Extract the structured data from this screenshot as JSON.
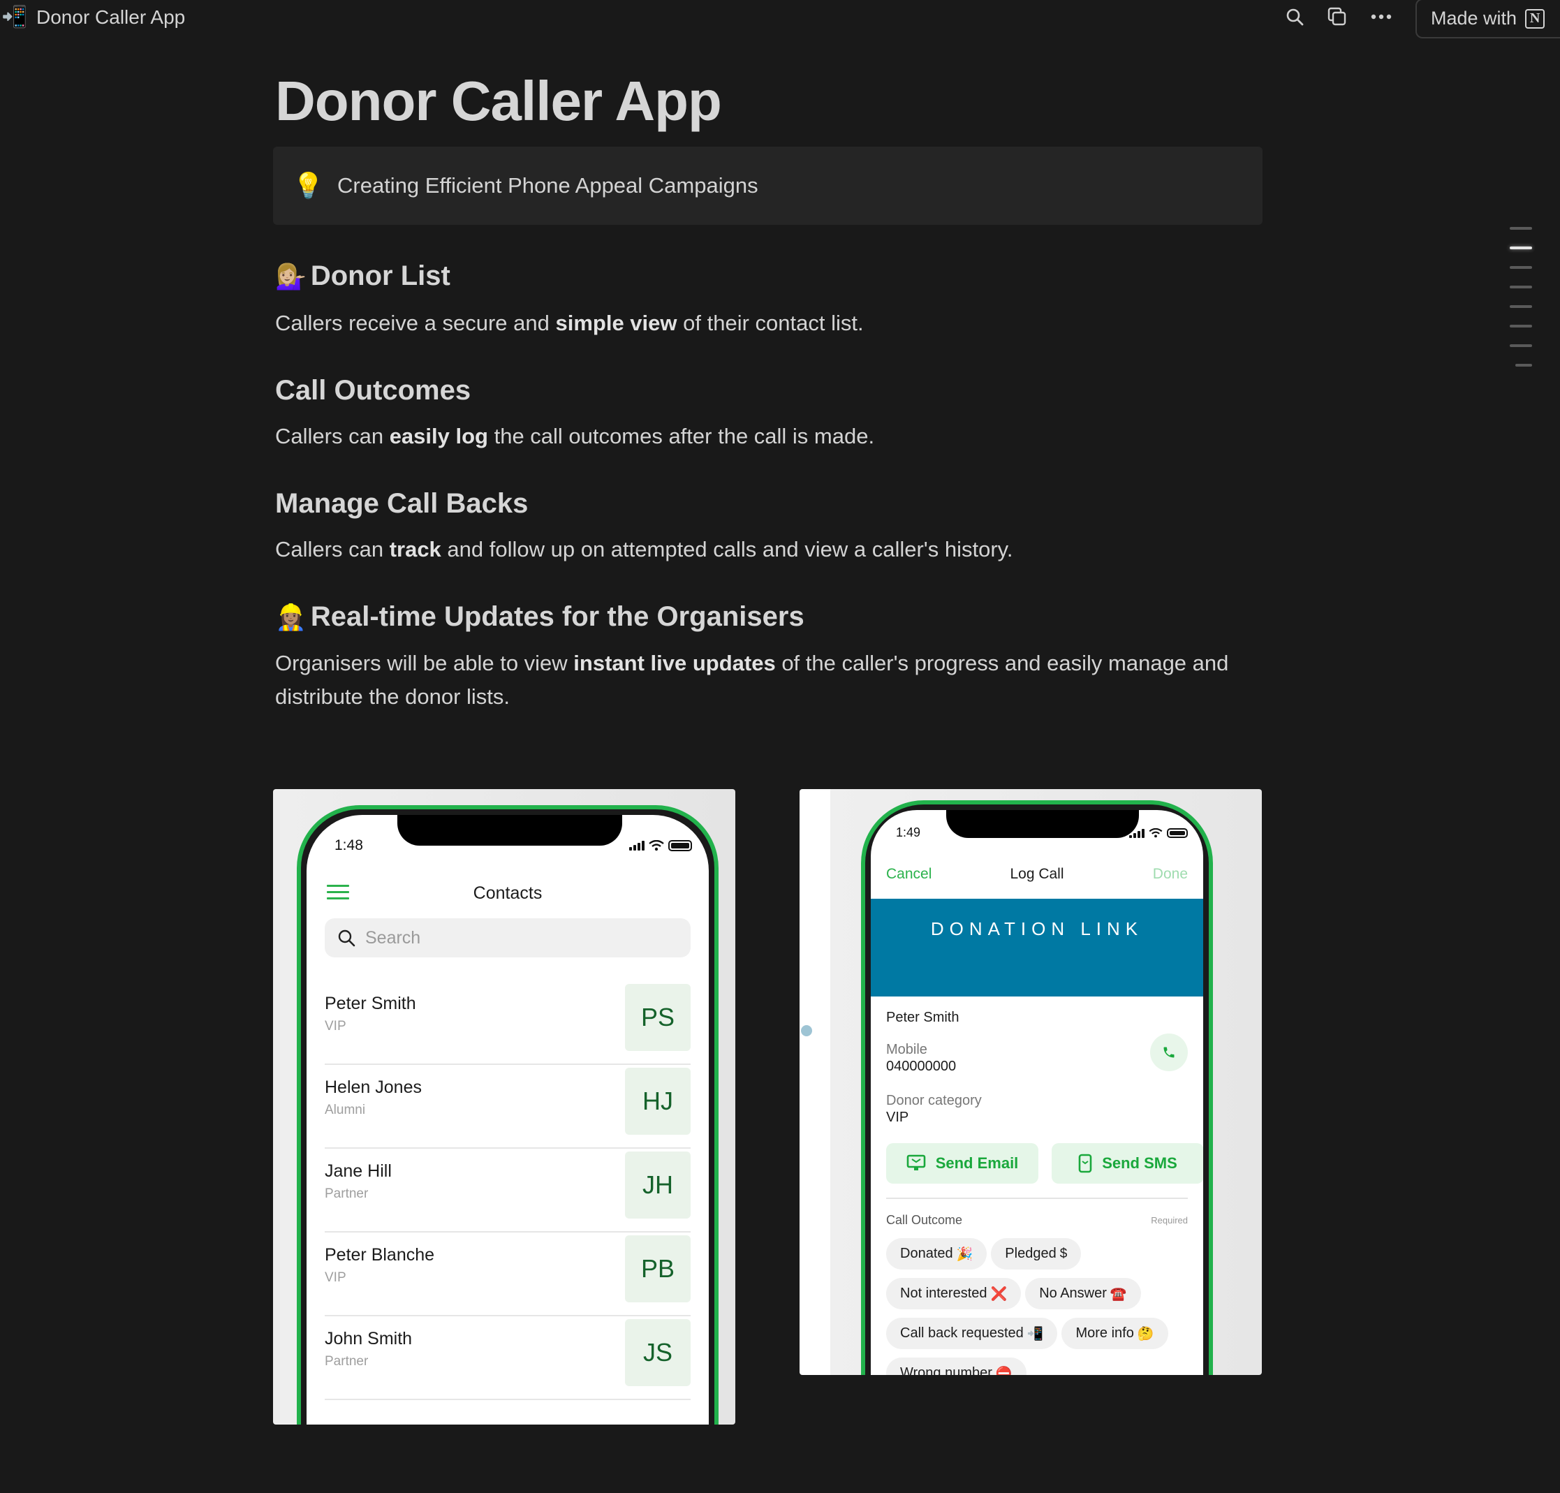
{
  "topbar": {
    "page_icon": "📲",
    "title": "Donor Caller App",
    "icons": [
      "search-icon",
      "duplicate-icon",
      "more-icon"
    ],
    "made_with_label": "Made with",
    "made_with_logo": "N"
  },
  "page": {
    "title": "Donor Caller App",
    "callout": {
      "icon": "💡",
      "text": "Creating Efficient Phone Appeal Campaigns"
    },
    "sections": [
      {
        "emoji": "💁🏼‍♀️",
        "heading": "Donor List",
        "paragraph": [
          {
            "t": "Callers receive a secure and "
          },
          {
            "t": "simple view",
            "b": true
          },
          {
            "t": " of their contact list."
          }
        ]
      },
      {
        "emoji": "",
        "heading": "Call Outcomes",
        "paragraph": [
          {
            "t": "Callers can "
          },
          {
            "t": "easily log",
            "b": true
          },
          {
            "t": " the call outcomes after the call is made."
          }
        ]
      },
      {
        "emoji": "",
        "heading": "Manage Call Backs",
        "paragraph": [
          {
            "t": "Callers can "
          },
          {
            "t": "track",
            "b": true
          },
          {
            "t": " and follow up on attempted calls and view a caller's history."
          }
        ]
      },
      {
        "emoji": "👷🏽‍♀️",
        "heading": "Real-time Updates for the Organisers",
        "paragraph": [
          {
            "t": "Organisers will be able to view "
          },
          {
            "t": "instant live updates",
            "b": true
          },
          {
            "t": " of the caller's progress and easily manage and distribute the donor lists."
          }
        ]
      }
    ]
  },
  "toc": {
    "count": 8,
    "active_index": 1
  },
  "contacts_screen": {
    "time": "1:48",
    "title": "Contacts",
    "search_placeholder": "Search",
    "contacts": [
      {
        "name": "Peter Smith",
        "category": "VIP",
        "initials": "PS"
      },
      {
        "name": "Helen Jones",
        "category": "Alumni",
        "initials": "HJ"
      },
      {
        "name": "Jane Hill",
        "category": "Partner",
        "initials": "JH"
      },
      {
        "name": "Peter Blanche",
        "category": "VIP",
        "initials": "PB"
      },
      {
        "name": "John Smith",
        "category": "Partner",
        "initials": "JS"
      }
    ]
  },
  "log_call_screen": {
    "time": "1:49",
    "cancel": "Cancel",
    "title": "Log Call",
    "done": "Done",
    "banner": "DONATION LINK",
    "donor_name": "Peter Smith",
    "mobile_label": "Mobile",
    "mobile_value": "040000000",
    "category_label": "Donor category",
    "category_value": "VIP",
    "send_email": "Send Email",
    "send_sms": "Send SMS",
    "outcome_label": "Call Outcome",
    "required_label": "Required",
    "outcomes": [
      {
        "label": "Donated",
        "emoji": "🎉"
      },
      {
        "label": "Pledged",
        "emoji": "$"
      },
      {
        "label": "Not interested",
        "emoji": "❌"
      },
      {
        "label": "No Answer",
        "emoji": "☎️"
      },
      {
        "label": "Call back requested",
        "emoji": "📲"
      },
      {
        "label": "More info",
        "emoji": "🤔"
      },
      {
        "label": "Wrong number",
        "emoji": "⛔"
      }
    ]
  },
  "colors": {
    "background": "#191919",
    "accent_green": "#2bb24c",
    "banner_blue": "#0079a3",
    "callout_bg": "#252525"
  }
}
